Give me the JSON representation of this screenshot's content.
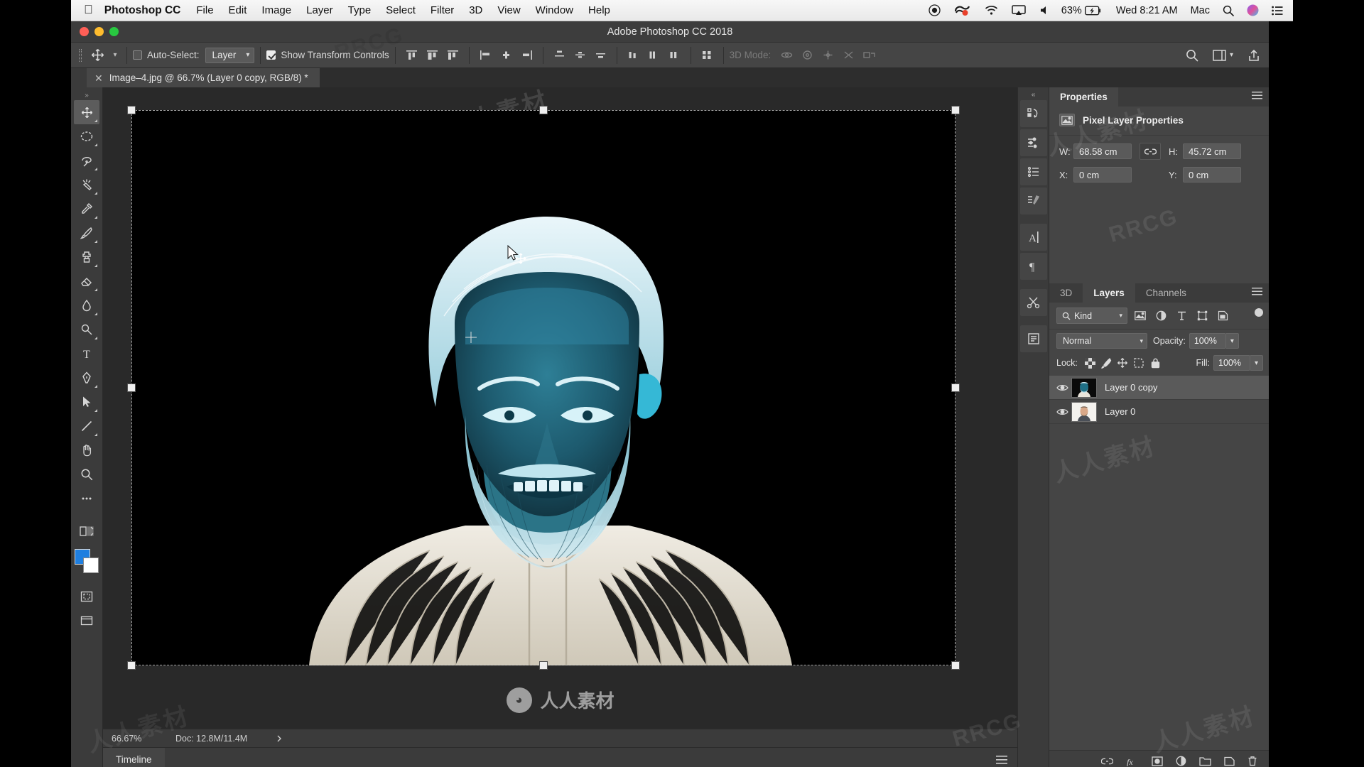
{
  "macbar": {
    "apple_icon": "apple-icon",
    "app_name": "Photoshop CC",
    "menus": [
      "File",
      "Edit",
      "Image",
      "Layer",
      "Type",
      "Select",
      "Filter",
      "3D",
      "View",
      "Window",
      "Help"
    ],
    "status_icons": [
      "record-icon",
      "screen-recording-icon",
      "wifi-icon",
      "airplay-icon",
      "volume-icon"
    ],
    "battery_percent": "63%",
    "battery_icon": "battery-charging-icon",
    "clock": "Wed 8:21 AM",
    "user": "Mac",
    "search_icon": "spotlight-search-icon",
    "siri_icon": "siri-icon",
    "control_center_icon": "notification-center-icon"
  },
  "window": {
    "title": "Adobe Photoshop CC 2018"
  },
  "options_bar": {
    "tool_icon": "move-tool-icon",
    "auto_select_label": "Auto-Select:",
    "auto_select_checked": false,
    "auto_select_value": "Layer",
    "show_transform_label": "Show Transform Controls",
    "show_transform_checked": true,
    "mode_3d_label": "3D Mode:",
    "align_icons": [
      "align-left-edges-icon",
      "align-horizontal-centers-icon",
      "align-right-edges-icon",
      "align-top-edges-icon",
      "align-vertical-centers-icon",
      "align-bottom-edges-icon"
    ],
    "distribute_icons": [
      "distribute-top-icon",
      "distribute-vertical-center-icon",
      "distribute-bottom-icon",
      "distribute-left-icon",
      "distribute-horizontal-center-icon",
      "distribute-right-icon"
    ],
    "extra_icons": [
      "align-distribute-options-icon"
    ],
    "mode3d_icons": [
      "3d-orbit-icon",
      "3d-roll-icon",
      "3d-pan-icon",
      "3d-slide-icon",
      "3d-scale-icon"
    ],
    "right_icons": [
      "search-icon",
      "workspace-icon",
      "share-icon"
    ]
  },
  "document_tab": {
    "close_icon": "close-icon",
    "title": "Image–4.jpg @ 66.7% (Layer 0 copy, RGB/8) *"
  },
  "toolbar": {
    "grip": "panel-grip-icon",
    "tools": [
      {
        "name": "move-tool",
        "icon": "move-tool-icon",
        "selected": true
      },
      {
        "name": "marquee-tool",
        "icon": "elliptical-marquee-icon",
        "selected": false
      },
      {
        "name": "lasso-tool",
        "icon": "lasso-icon",
        "selected": false
      },
      {
        "name": "quick-selection-tool",
        "icon": "magic-wand-icon",
        "selected": false
      },
      {
        "name": "eyedropper-tool",
        "icon": "eyedropper-icon",
        "selected": false
      },
      {
        "name": "brush-tool",
        "icon": "brush-icon",
        "selected": false
      },
      {
        "name": "clone-stamp-tool",
        "icon": "clone-stamp-icon",
        "selected": false
      },
      {
        "name": "eraser-tool",
        "icon": "eraser-icon",
        "selected": false
      },
      {
        "name": "blur-tool",
        "icon": "blur-icon",
        "selected": false
      },
      {
        "name": "dodge-tool",
        "icon": "dodge-icon",
        "selected": false
      },
      {
        "name": "type-tool",
        "icon": "type-tool-icon",
        "selected": false
      },
      {
        "name": "pen-tool",
        "icon": "pen-tool-icon",
        "selected": false
      },
      {
        "name": "path-selection-tool",
        "icon": "path-selection-icon",
        "selected": false
      },
      {
        "name": "line-tool",
        "icon": "line-tool-icon",
        "selected": false
      },
      {
        "name": "hand-tool",
        "icon": "hand-tool-icon",
        "selected": false
      },
      {
        "name": "zoom-tool",
        "icon": "zoom-tool-icon",
        "selected": false
      },
      {
        "name": "more-tools",
        "icon": "ellipsis-icon",
        "selected": false
      }
    ],
    "quick_mask_icon": "quick-mask-icon",
    "screen_mode_icon": "screen-mode-icon",
    "foreground_color": "#1f7fe0",
    "background_color": "#ffffff"
  },
  "canvas": {
    "transform_handles": 8,
    "selected_layer_preview": "inverted-portrait-image"
  },
  "status_bar": {
    "zoom": "66.67%",
    "doc_label": "Doc: 12.8M/11.4M",
    "expand_icon": "chevron-right-icon"
  },
  "timeline": {
    "tab_label": "Timeline",
    "menu_icon": "panel-menu-icon"
  },
  "rail": {
    "collapse_icon": "double-chevron-right-icon",
    "buttons": [
      {
        "name": "history-panel-button",
        "icon": "history-icon"
      },
      {
        "name": "actions-panel-button",
        "icon": "actions-icon"
      },
      {
        "name": "adjustments-panel-button",
        "icon": "adjustments-icon"
      },
      {
        "name": "libraries-panel-button",
        "icon": "libraries-icon"
      },
      {
        "name": "character-panel-button",
        "icon": "character-icon"
      },
      {
        "name": "paragraph-panel-button",
        "icon": "paragraph-icon"
      },
      {
        "name": "tools-presets-button",
        "icon": "scissors-icon"
      },
      {
        "name": "notes-panel-button",
        "icon": "notes-icon"
      }
    ]
  },
  "properties_panel": {
    "tab_label": "Properties",
    "menu_icon": "panel-menu-icon",
    "section_icon": "pixel-layer-icon",
    "section_title": "Pixel Layer Properties",
    "fields": {
      "w_label": "W:",
      "w_value": "68.58 cm",
      "h_label": "H:",
      "h_value": "45.72 cm",
      "x_label": "X:",
      "x_value": "0 cm",
      "y_label": "Y:",
      "y_value": "0 cm",
      "link_icon": "link-icon"
    }
  },
  "layers_panel": {
    "tabs": [
      {
        "label": "3D",
        "active": false
      },
      {
        "label": "Layers",
        "active": true
      },
      {
        "label": "Channels",
        "active": false
      }
    ],
    "menu_icon": "panel-menu-icon",
    "filter": {
      "search_icon": "search-icon",
      "kind_label": "Kind",
      "chevron_icon": "chevron-down-icon",
      "type_icons": [
        "pixel-filter-icon",
        "adjustment-filter-icon",
        "type-filter-icon",
        "shape-filter-icon",
        "smart-object-filter-icon"
      ],
      "toggle_icon": "filter-toggle-icon"
    },
    "blend": {
      "mode": "Normal",
      "chevron_icon": "chevron-down-icon",
      "opacity_label": "Opacity:",
      "opacity_value": "100%"
    },
    "lock": {
      "label": "Lock:",
      "icons": [
        "lock-transparency-icon",
        "lock-image-icon",
        "lock-position-icon",
        "lock-artboard-icon",
        "lock-all-icon"
      ],
      "fill_label": "Fill:",
      "fill_value": "100%"
    },
    "layers": [
      {
        "name": "Layer 0 copy",
        "visible": true,
        "selected": true,
        "thumb": "inverted-portrait-thumb",
        "eye_icon": "eye-icon"
      },
      {
        "name": "Layer 0",
        "visible": true,
        "selected": false,
        "thumb": "portrait-thumb",
        "eye_icon": "eye-icon"
      }
    ],
    "footer_icons": [
      "link-layers-icon",
      "layer-style-icon",
      "add-mask-icon",
      "adjustment-layer-icon",
      "new-group-icon",
      "new-layer-icon",
      "delete-layer-icon"
    ]
  },
  "watermarks": {
    "cn": "人人素材",
    "en": "RRCG",
    "center": "人人素材",
    "logo": "rrcg-logo-icon"
  }
}
